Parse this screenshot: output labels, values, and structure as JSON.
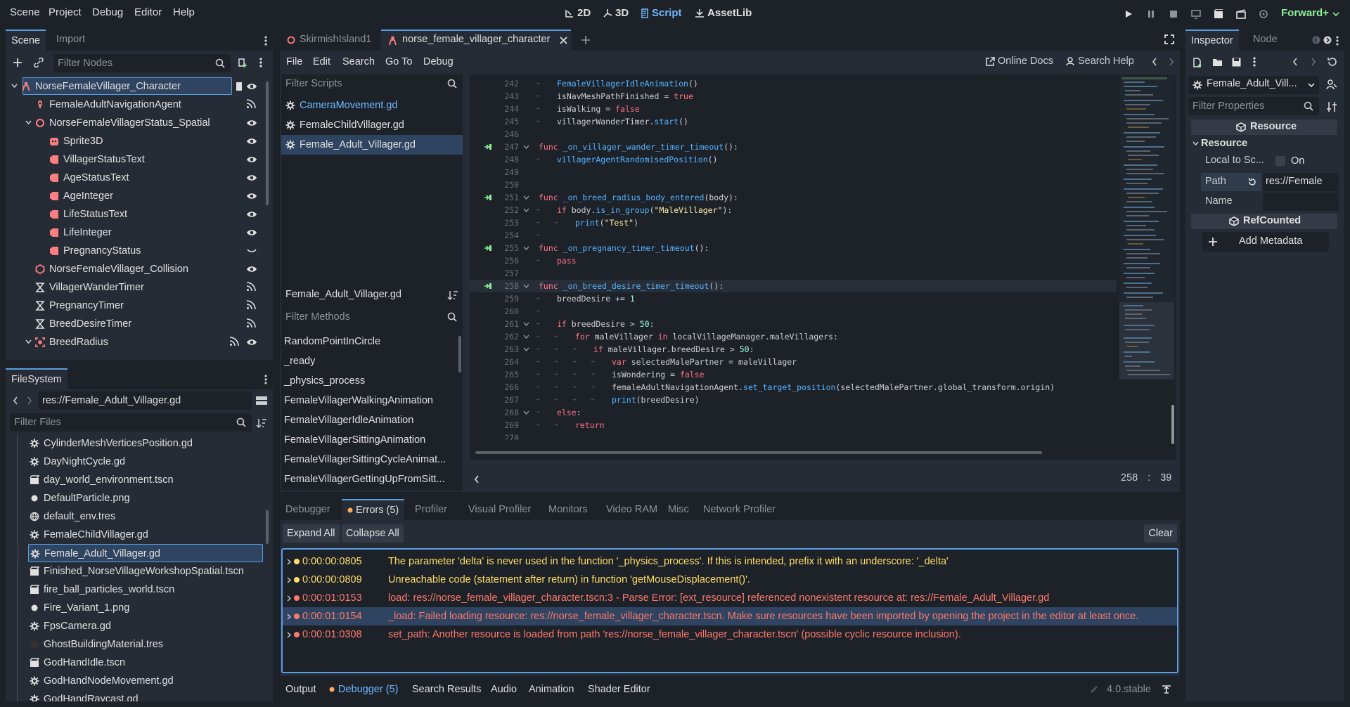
{
  "menu": [
    "Scene",
    "Project",
    "Debug",
    "Editor",
    "Help"
  ],
  "workspaces": [
    {
      "label": "2D",
      "icon": "2d-icon"
    },
    {
      "label": "3D",
      "icon": "3d-icon"
    },
    {
      "label": "Script",
      "icon": "script-icon"
    },
    {
      "label": "AssetLib",
      "icon": "assetlib-icon"
    }
  ],
  "renderer": "Forward+",
  "scene_dock": {
    "tabs": [
      "Scene",
      "Import"
    ],
    "filter_placeholder": "Filter Nodes",
    "nodes": [
      {
        "label": "NorseFemaleVillager_Character",
        "depth": 0,
        "icon": "character-icon",
        "color": "#fc7f7f",
        "vis": "eye"
      },
      {
        "label": "FemaleAdultNavigationAgent",
        "depth": 1,
        "icon": "navigation-agent-icon",
        "color": "#fc7f7f",
        "vis": "signal"
      },
      {
        "label": "NorseFemaleVillagerStatus_Spatial",
        "depth": 1,
        "icon": "node3d-icon",
        "color": "#fc7f7f",
        "vis": "eye"
      },
      {
        "label": "Sprite3D",
        "depth": 2,
        "icon": "sprite3d-icon",
        "color": "#fc7f7f",
        "vis": "eye"
      },
      {
        "label": "VillagerStatusText",
        "depth": 2,
        "icon": "label3d-icon",
        "color": "#fc7f7f",
        "vis": "eye"
      },
      {
        "label": "AgeStatusText",
        "depth": 2,
        "icon": "label3d-icon",
        "color": "#fc7f7f",
        "vis": "eye"
      },
      {
        "label": "AgeInteger",
        "depth": 2,
        "icon": "label3d-icon",
        "color": "#fc7f7f",
        "vis": "eye"
      },
      {
        "label": "LifeStatusText",
        "depth": 2,
        "icon": "label3d-icon",
        "color": "#fc7f7f",
        "vis": "eye"
      },
      {
        "label": "LifeInteger",
        "depth": 2,
        "icon": "label3d-icon",
        "color": "#fc7f7f",
        "vis": "eye"
      },
      {
        "label": "PregnancyStatus",
        "depth": 2,
        "icon": "label3d-icon",
        "color": "#fc7f7f",
        "vis": "eye-closed"
      },
      {
        "label": "NorseFemaleVillager_Collision",
        "depth": 1,
        "icon": "collision-icon",
        "color": "#fc7f7f",
        "vis": "eye"
      },
      {
        "label": "VillagerWanderTimer",
        "depth": 1,
        "icon": "timer-icon",
        "color": "#e0e0e0",
        "vis": "signal"
      },
      {
        "label": "PregnancyTimer",
        "depth": 1,
        "icon": "timer-icon",
        "color": "#e0e0e0",
        "vis": "signal"
      },
      {
        "label": "BreedDesireTimer",
        "depth": 1,
        "icon": "timer-icon",
        "color": "#e0e0e0",
        "vis": "signal"
      },
      {
        "label": "BreedRadius",
        "depth": 1,
        "icon": "area3d-icon",
        "color": "#fc7f7f",
        "vis": "signal-eye"
      }
    ]
  },
  "filesystem": {
    "tab": "FileSystem",
    "path": "res://Female_Adult_Villager.gd",
    "filter_placeholder": "Filter Files",
    "files": [
      {
        "label": "CylinderMeshVerticesPosition.gd",
        "icon": "gear-icon"
      },
      {
        "label": "DayNightCycle.gd",
        "icon": "gear-icon"
      },
      {
        "label": "day_world_environment.tscn",
        "icon": "scene-icon"
      },
      {
        "label": "DefaultParticle.png",
        "icon": "image-icon"
      },
      {
        "label": "default_env.tres",
        "icon": "resource-icon"
      },
      {
        "label": "FemaleChildVillager.gd",
        "icon": "gear-icon"
      },
      {
        "label": "Female_Adult_Villager.gd",
        "icon": "gear-icon",
        "selected": true
      },
      {
        "label": "Finished_NorseVillageWorkshopSpatial.tscn",
        "icon": "scene-icon"
      },
      {
        "label": "fire_ball_particles_world.tscn",
        "icon": "scene-icon"
      },
      {
        "label": "Fire_Variant_1.png",
        "icon": "image-icon"
      },
      {
        "label": "FpsCamera.gd",
        "icon": "gear-icon"
      },
      {
        "label": "GhostBuildingMaterial.tres",
        "icon": "material-icon"
      },
      {
        "label": "GodHandIdle.tscn",
        "icon": "scene-icon"
      },
      {
        "label": "GodHandNodeMovement.gd",
        "icon": "gear-icon"
      },
      {
        "label": "GodHandRaycast.gd",
        "icon": "gear-icon"
      }
    ]
  },
  "editor_tabs": [
    {
      "label": "SkirmishIsland1",
      "icon": "node3d-icon"
    },
    {
      "label": "norse_female_villager_character",
      "icon": "character-icon",
      "active": true
    }
  ],
  "script_menu": [
    "File",
    "Edit",
    "Search",
    "Go To",
    "Debug"
  ],
  "online_docs": "Online Docs",
  "search_help": "Search Help",
  "scripts_filter": "Filter Scripts",
  "scripts": [
    {
      "label": "CameraMovement.gd",
      "color": "#70b8ff"
    },
    {
      "label": "FemaleChildVillager.gd",
      "color": "#e0e0e0"
    },
    {
      "label": "Female_Adult_Villager.gd",
      "color": "#e0e0e0",
      "selected": true
    }
  ],
  "current_script": "Female_Adult_Villager.gd",
  "methods_filter": "Filter Methods",
  "methods": [
    "RandomPointInCircle",
    "_ready",
    "_physics_process",
    "FemaleVillagerWalkingAnimation",
    "FemaleVillagerIdleAnimation",
    "FemaleVillagerSittingAnimation",
    "FemaleVillagerSittingCycleAnimat...",
    "FemaleVillagerGettingUpFromSitt..."
  ],
  "code": [
    {
      "n": "242",
      "indent": 1,
      "html": "<span class=\"fn\">FemaleVillagerIdleAnimation</span>()"
    },
    {
      "n": "243",
      "indent": 1,
      "html": "isNavMeshPathFinished = <span class=\"kw\">true</span>"
    },
    {
      "n": "244",
      "indent": 1,
      "html": "isWalking = <span class=\"kw\">false</span>"
    },
    {
      "n": "245",
      "indent": 1,
      "html": "villagerWanderTimer.<span class=\"fn\">start</span>()"
    },
    {
      "n": "246",
      "indent": 0,
      "html": ""
    },
    {
      "n": "247",
      "indent": 0,
      "sig": true,
      "fold": true,
      "html": "<span class=\"kw\">func</span> <span class=\"fn\">_on_villager_wander_timer_timeout</span>():"
    },
    {
      "n": "248",
      "indent": 1,
      "html": "<span class=\"fn\">villagerAgentRandomisedPosition</span>()"
    },
    {
      "n": "249",
      "indent": 0,
      "html": ""
    },
    {
      "n": "250",
      "indent": 0,
      "html": ""
    },
    {
      "n": "251",
      "indent": 0,
      "sig": true,
      "fold": true,
      "html": "<span class=\"kw\">func</span> <span class=\"fn\">_on_breed_radius_body_entered</span>(body):"
    },
    {
      "n": "252",
      "indent": 1,
      "fold": true,
      "html": "<span class=\"kw\">if</span> body.<span class=\"fn\">is_in_group</span>(<span class=\"str\">\"MaleVillager\"</span>):"
    },
    {
      "n": "253",
      "indent": 2,
      "html": "<span class=\"fn\">print</span>(<span class=\"str\">\"Test\"</span>)"
    },
    {
      "n": "254",
      "indent": 1,
      "html": ""
    },
    {
      "n": "255",
      "indent": 0,
      "sig": true,
      "fold": true,
      "html": "<span class=\"kw\">func</span> <span class=\"fn\">_on_pregnancy_timer_timeout</span>():"
    },
    {
      "n": "256",
      "indent": 1,
      "html": "<span class=\"kw\">pass</span>"
    },
    {
      "n": "257",
      "indent": 0,
      "html": ""
    },
    {
      "n": "258",
      "indent": 0,
      "sig": true,
      "fold": true,
      "current": true,
      "html": "<span class=\"kw\">func</span> <span class=\"fn\">_on_breed_desire_timer_timeout</span>():"
    },
    {
      "n": "259",
      "indent": 1,
      "html": "breedDesire += <span class=\"num\">1</span>"
    },
    {
      "n": "260",
      "indent": 1,
      "html": ""
    },
    {
      "n": "261",
      "indent": 1,
      "fold": true,
      "html": "<span class=\"kw\">if</span> breedDesire &gt; <span class=\"num\">50</span>:"
    },
    {
      "n": "262",
      "indent": 2,
      "fold": true,
      "html": "<span class=\"kw\">for</span> maleVillager <span class=\"kw\">in</span> localVillageManager.maleVillagers:"
    },
    {
      "n": "263",
      "indent": 3,
      "fold": true,
      "html": "<span class=\"kw\">if</span> maleVillager.breedDesire &gt; <span class=\"num\">50</span>:"
    },
    {
      "n": "264",
      "indent": 4,
      "html": "<span class=\"kw\">var</span> selectedMalePartner = maleVillager"
    },
    {
      "n": "265",
      "indent": 4,
      "html": "isWondering = <span class=\"kw\">false</span>"
    },
    {
      "n": "266",
      "indent": 4,
      "html": "femaleAdultNavigationAgent.<span class=\"fn\">set_target_position</span>(selectedMalePartner.global_transform.origin)"
    },
    {
      "n": "267",
      "indent": 4,
      "html": "<span class=\"fn\">print</span>(breedDesire)"
    },
    {
      "n": "268",
      "indent": 1,
      "fold": true,
      "html": "<span class=\"kw\">else</span>:"
    },
    {
      "n": "269",
      "indent": 2,
      "html": "<span class=\"kw\">return</span>"
    },
    {
      "n": "270",
      "indent": 0,
      "html": ""
    }
  ],
  "cursor": {
    "line": "258",
    "sep": ":",
    "col": "39"
  },
  "debugger": {
    "tabs": [
      "Debugger",
      "Errors (5)",
      "Profiler",
      "Visual Profiler",
      "Monitors",
      "Video RAM",
      "Misc",
      "Network Profiler"
    ],
    "expand_all": "Expand All",
    "collapse_all": "Collapse All",
    "clear": "Clear",
    "errors": [
      {
        "time": "0:00:00:0805",
        "level": "warning",
        "msg": "The parameter 'delta' is never used in the function '_physics_process'. If this is intended, prefix it with an underscore: '_delta'"
      },
      {
        "time": "0:00:00:0809",
        "level": "warning",
        "msg": "Unreachable code (statement after return) in function 'getMouseDisplacement()'."
      },
      {
        "time": "0:00:01:0153",
        "level": "error",
        "msg": "load: res://norse_female_villager_character.tscn:3 - Parse Error: [ext_resource] referenced nonexistent resource at: res://Female_Adult_Villager.gd"
      },
      {
        "time": "0:00:01:0154",
        "level": "error",
        "selected": true,
        "msg": "_load: Failed loading resource: res://norse_female_villager_character.tscn. Make sure resources have been imported by opening the project in the editor at least once."
      },
      {
        "time": "0:00:01:0308",
        "level": "error",
        "msg": "set_path: Another resource is loaded from path 'res://norse_female_villager_character.tscn' (possible cyclic resource inclusion)."
      }
    ]
  },
  "bottom_tabs": [
    "Output",
    "Debugger (5)",
    "Search Results",
    "Audio",
    "Animation",
    "Shader Editor"
  ],
  "version": "4.0.stable",
  "inspector": {
    "tabs": [
      "Inspector",
      "Node"
    ],
    "object": "Female_Adult_Vill...",
    "filter_placeholder": "Filter Properties",
    "resource_header": "Resource",
    "resource_section": "Resource",
    "local_to_scene_label": "Local to Sc...",
    "local_to_scene_value": "On",
    "path_label": "Path",
    "path_value": "res://Female",
    "name_label": "Name",
    "refcounted_header": "RefCounted",
    "add_metadata": "Add Metadata"
  },
  "colors": {
    "accent": "#70b8ff",
    "warning": "#ffdd65",
    "error": "#ff786b",
    "node3d": "#fc7f7f",
    "renderer": "#8eef97"
  }
}
